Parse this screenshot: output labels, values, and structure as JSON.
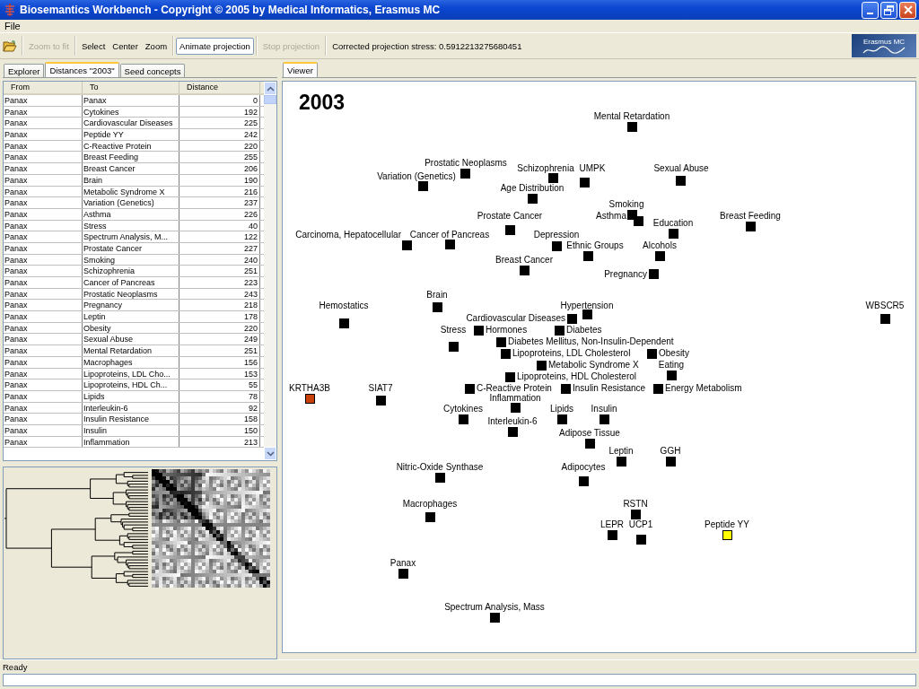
{
  "window": {
    "title": "Biosemantics Workbench - Copyright © 2005 by Medical Informatics, Erasmus MC"
  },
  "menu": [
    "File"
  ],
  "toolbar": {
    "items": [
      {
        "kind": "open"
      },
      {
        "kind": "separator"
      },
      {
        "kind": "button",
        "label": "Zoom to fit",
        "disabled": true
      },
      {
        "kind": "separator"
      },
      {
        "kind": "button",
        "label": "Select",
        "disabled": false
      },
      {
        "kind": "button",
        "label": "Center",
        "disabled": false
      },
      {
        "kind": "button",
        "label": "Zoom",
        "disabled": false
      },
      {
        "kind": "separator"
      },
      {
        "kind": "raised",
        "label": "Animate projection",
        "disabled": false
      },
      {
        "kind": "separator"
      },
      {
        "kind": "button",
        "label": "Stop projection",
        "disabled": true
      },
      {
        "kind": "separator"
      },
      {
        "kind": "text",
        "label": "Corrected projection stress: 0.5912213275680451"
      }
    ],
    "logo": "Erasmus MC"
  },
  "left_tabs": [
    {
      "label": "Explorer",
      "selected": false
    },
    {
      "label": "Distances \"2003\"",
      "selected": true
    },
    {
      "label": "Seed concepts",
      "selected": false
    }
  ],
  "table": {
    "columns": [
      "From",
      "To",
      "Distance"
    ],
    "rows": [
      [
        "Panax",
        "Panax",
        "0"
      ],
      [
        "Panax",
        "Cytokines",
        "192"
      ],
      [
        "Panax",
        "Cardiovascular Diseases",
        "225"
      ],
      [
        "Panax",
        "Peptide YY",
        "242"
      ],
      [
        "Panax",
        "C-Reactive Protein",
        "220"
      ],
      [
        "Panax",
        "Breast Feeding",
        "255"
      ],
      [
        "Panax",
        "Breast Cancer",
        "206"
      ],
      [
        "Panax",
        "Brain",
        "190"
      ],
      [
        "Panax",
        "Metabolic Syndrome X",
        "216"
      ],
      [
        "Panax",
        "Variation (Genetics)",
        "237"
      ],
      [
        "Panax",
        "Asthma",
        "226"
      ],
      [
        "Panax",
        "Stress",
        "40"
      ],
      [
        "Panax",
        "Spectrum Analysis, M...",
        "122"
      ],
      [
        "Panax",
        "Prostate Cancer",
        "227"
      ],
      [
        "Panax",
        "Smoking",
        "240"
      ],
      [
        "Panax",
        "Schizophrenia",
        "251"
      ],
      [
        "Panax",
        "Cancer of Pancreas",
        "223"
      ],
      [
        "Panax",
        "Prostatic Neoplasms",
        "243"
      ],
      [
        "Panax",
        "Pregnancy",
        "218"
      ],
      [
        "Panax",
        "Leptin",
        "178"
      ],
      [
        "Panax",
        "Obesity",
        "220"
      ],
      [
        "Panax",
        "Sexual Abuse",
        "249"
      ],
      [
        "Panax",
        "Mental Retardation",
        "251"
      ],
      [
        "Panax",
        "Macrophages",
        "156"
      ],
      [
        "Panax",
        "Lipoproteins, LDL Cho...",
        "153"
      ],
      [
        "Panax",
        "Lipoproteins, HDL Ch...",
        "55"
      ],
      [
        "Panax",
        "Lipids",
        "78"
      ],
      [
        "Panax",
        "Interleukin-6",
        "92"
      ],
      [
        "Panax",
        "Insulin Resistance",
        "158"
      ],
      [
        "Panax",
        "Insulin",
        "150"
      ],
      [
        "Panax",
        "Inflammation",
        "213"
      ]
    ]
  },
  "viewer": {
    "tabs": [
      {
        "label": "Viewer",
        "selected": true
      }
    ],
    "year": "2003",
    "nodes": [
      {
        "label": "Mental Retardation",
        "color": "#000000"
      },
      {
        "label": "Prostatic Neoplasms",
        "color": "#000000"
      },
      {
        "label": "Schizophrenia",
        "color": "#000000"
      },
      {
        "label": "UMPK",
        "color": "#000000"
      },
      {
        "label": "Sexual Abuse",
        "color": "#000000"
      },
      {
        "label": "Variation (Genetics)",
        "color": "#000000"
      },
      {
        "label": "Age Distribution",
        "color": "#000000"
      },
      {
        "label": "Smoking",
        "color": "#000000"
      },
      {
        "label": "Prostate Cancer",
        "color": "#000000"
      },
      {
        "label": "Asthma",
        "color": "#000000"
      },
      {
        "label": "Breast Feeding",
        "color": "#000000"
      },
      {
        "label": "Education",
        "color": "#000000"
      },
      {
        "label": "Carcinoma, Hepatocellular",
        "color": "#000000"
      },
      {
        "label": "Cancer of Pancreas",
        "color": "#000000"
      },
      {
        "label": "Depression",
        "color": "#000000"
      },
      {
        "label": "Ethnic Groups",
        "color": "#000000"
      },
      {
        "label": "Alcohols",
        "color": "#000000"
      },
      {
        "label": "Breast Cancer",
        "color": "#000000"
      },
      {
        "label": "Pregnancy",
        "color": "#000000"
      },
      {
        "label": "Brain",
        "color": "#000000"
      },
      {
        "label": "Hemostatics",
        "color": "#000000"
      },
      {
        "label": "Hypertension",
        "color": "#000000"
      },
      {
        "label": "WBSCR5",
        "color": "#000000"
      },
      {
        "label": "Cardiovascular Diseases",
        "color": "#000000"
      },
      {
        "label": "Stress",
        "color": "#000000"
      },
      {
        "label": "Hormones",
        "color": "#000000"
      },
      {
        "label": "Diabetes",
        "color": "#000000"
      },
      {
        "label": "Diabetes Mellitus, Non-Insulin-Dependent",
        "color": "#000000"
      },
      {
        "label": "Lipoproteins, LDL Cholesterol",
        "color": "#000000"
      },
      {
        "label": "Obesity",
        "color": "#000000"
      },
      {
        "label": "Metabolic Syndrome X",
        "color": "#000000"
      },
      {
        "label": "Eating",
        "color": "#000000"
      },
      {
        "label": "Lipoproteins, HDL Cholesterol",
        "color": "#000000"
      },
      {
        "label": "KRTHA3B",
        "color": "#c8400c"
      },
      {
        "label": "SIAT7",
        "color": "#000000"
      },
      {
        "label": "C-Reactive Protein",
        "color": "#000000"
      },
      {
        "label": "Insulin Resistance",
        "color": "#000000"
      },
      {
        "label": "Energy Metabolism",
        "color": "#000000"
      },
      {
        "label": "Inflammation",
        "color": "#000000"
      },
      {
        "label": "Cytokines",
        "color": "#000000"
      },
      {
        "label": "Lipids",
        "color": "#000000"
      },
      {
        "label": "Insulin",
        "color": "#000000"
      },
      {
        "label": "Interleukin-6",
        "color": "#000000"
      },
      {
        "label": "Adipose Tissue",
        "color": "#000000"
      },
      {
        "label": "Leptin",
        "color": "#000000"
      },
      {
        "label": "GGH",
        "color": "#000000"
      },
      {
        "label": "Nitric-Oxide Synthase",
        "color": "#000000"
      },
      {
        "label": "Adipocytes",
        "color": "#000000"
      },
      {
        "label": "Macrophages",
        "color": "#000000"
      },
      {
        "label": "RSTN",
        "color": "#000000"
      },
      {
        "label": "LEPR",
        "color": "#000000"
      },
      {
        "label": "UCP1",
        "color": "#000000"
      },
      {
        "label": "Peptide YY",
        "color": "#ffff00"
      },
      {
        "label": "Panax",
        "color": "#000000"
      },
      {
        "label": "Spectrum Analysis, Mass",
        "color": "#000000"
      }
    ]
  },
  "status_bar": {
    "text": "Ready"
  }
}
